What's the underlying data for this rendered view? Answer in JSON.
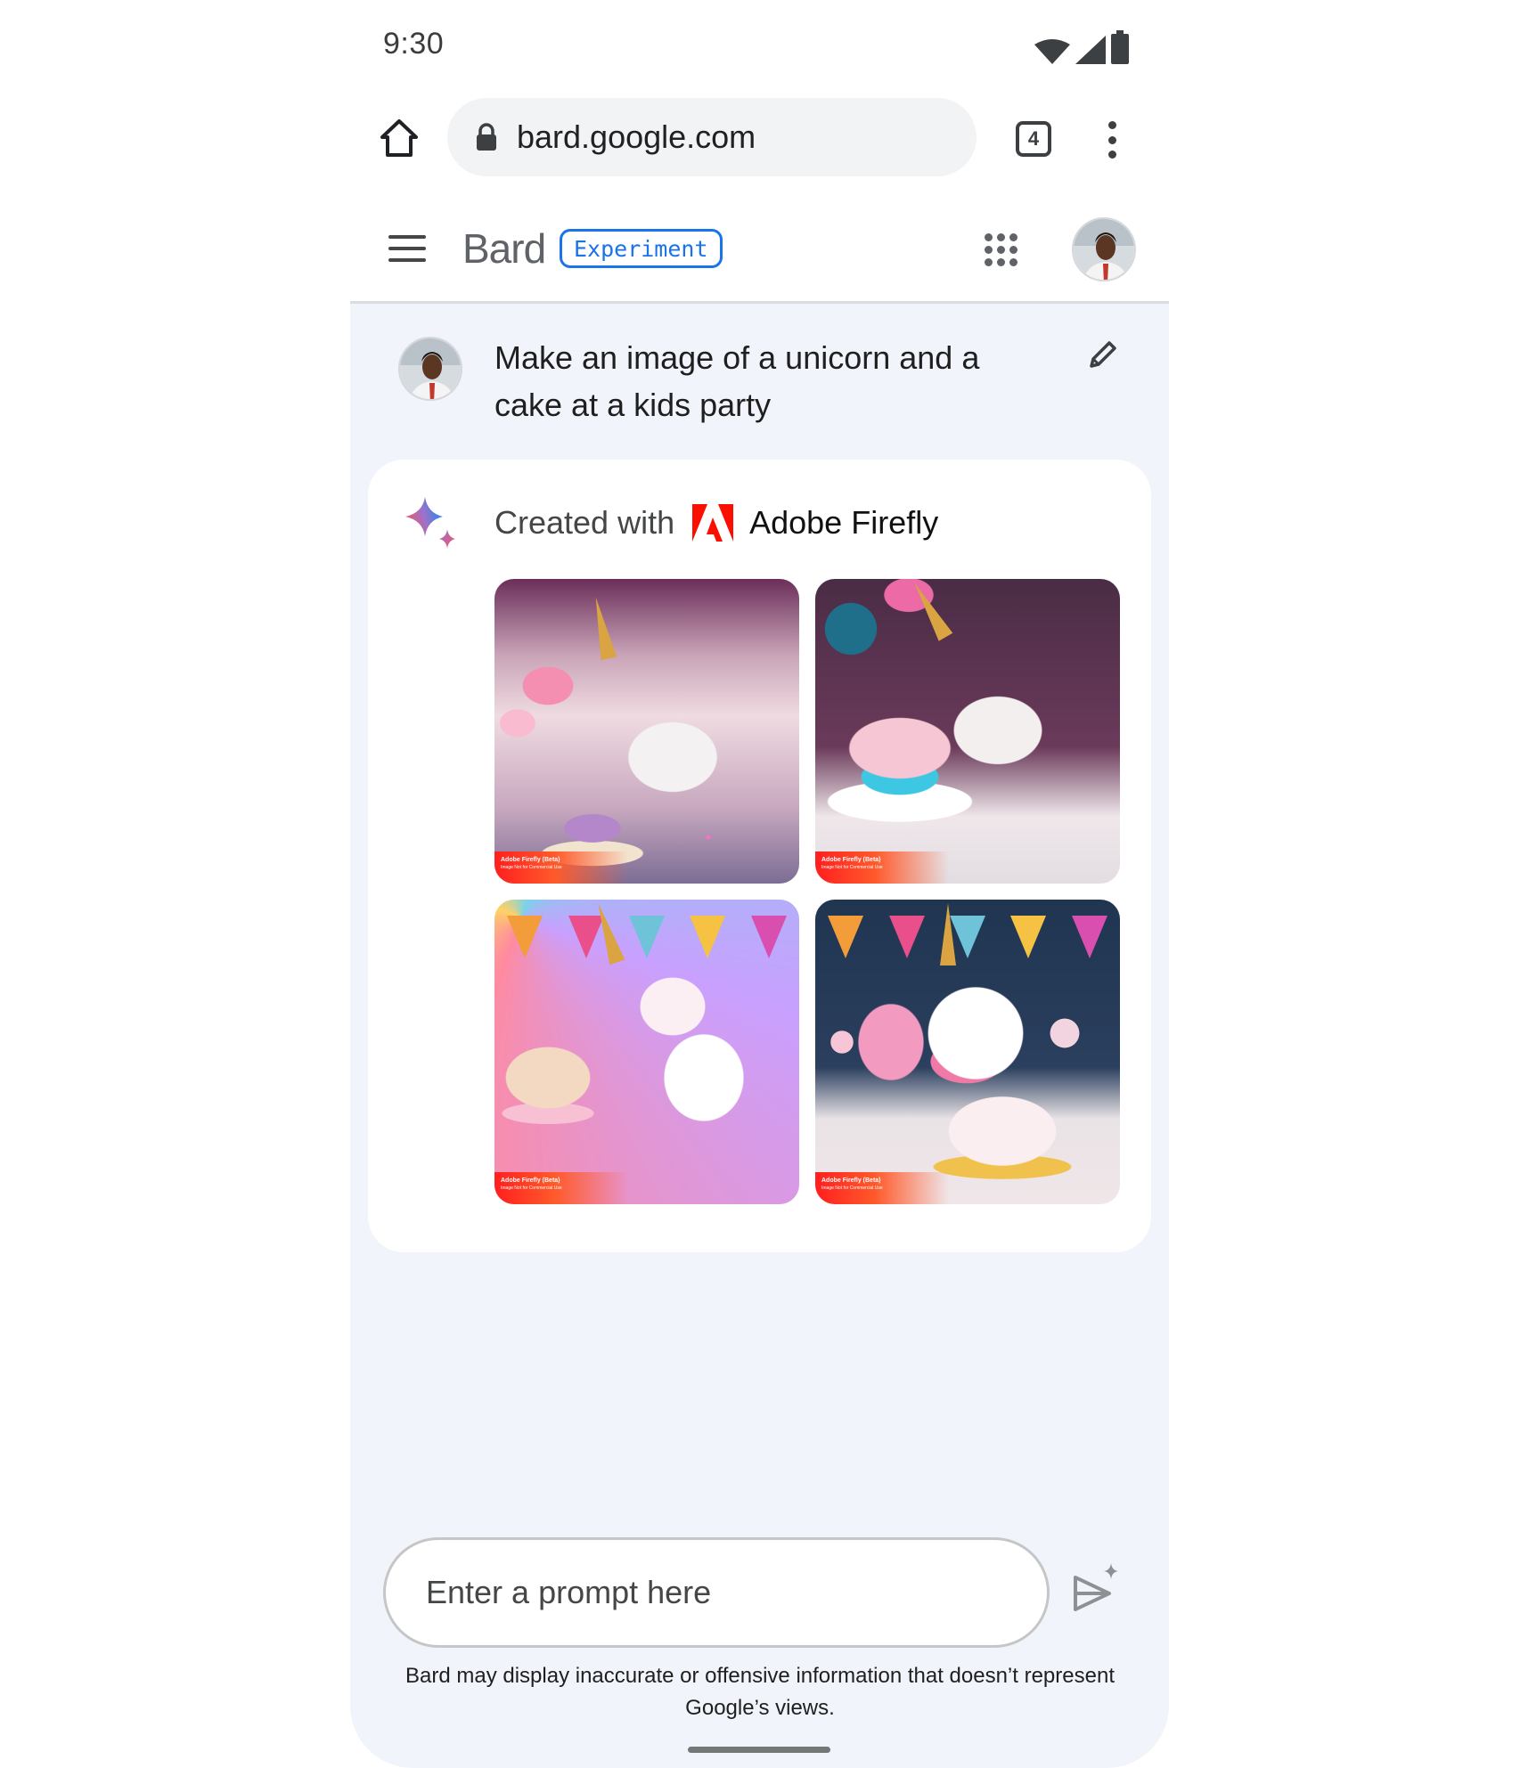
{
  "status_bar": {
    "time": "9:30",
    "icons": [
      "wifi-icon",
      "signal-icon",
      "battery-icon"
    ]
  },
  "browser": {
    "url": "bard.google.com",
    "tab_count": "4",
    "icons": [
      "home-icon",
      "lock-icon",
      "tab-switcher-icon",
      "more-vert-icon"
    ]
  },
  "app_bar": {
    "title": "Bard",
    "badge": "Experiment",
    "icons": [
      "menu-icon",
      "apps-grid-icon",
      "account-avatar"
    ]
  },
  "conversation": {
    "user_prompt": "Make an image of a unicorn and a cake at a kids party",
    "response": {
      "created_with_label": "Created with",
      "provider": "Adobe Firefly",
      "images": [
        {
          "description": "Unicorn beside a layered purple cake with candles and pink balloons",
          "watermark_title": "Adobe Firefly (Beta)",
          "watermark_sub": "Image Not for Commercial Use"
        },
        {
          "description": "Unicorn next to a drip cake with lit candles and blue balloon",
          "watermark_title": "Adobe Firefly (Beta)",
          "watermark_sub": "Image Not for Commercial Use"
        },
        {
          "description": "Cartoon unicorn beside a cake on a stand with bunting flags",
          "watermark_title": "Adobe Firefly (Beta)",
          "watermark_sub": "Image Not for Commercial Use"
        },
        {
          "description": "Pink-maned unicorn behind a drip cake with bunting and balloons",
          "watermark_title": "Adobe Firefly (Beta)",
          "watermark_sub": "Image Not for Commercial Use"
        }
      ]
    }
  },
  "input": {
    "placeholder": "Enter a prompt here",
    "value": ""
  },
  "disclaimer": "Bard may display inaccurate or offensive information that doesn’t represent Google’s views.",
  "colors": {
    "accent": "#1a73e8",
    "body_background": "#f1f4fb",
    "adobe_red": "#fa0f00"
  }
}
